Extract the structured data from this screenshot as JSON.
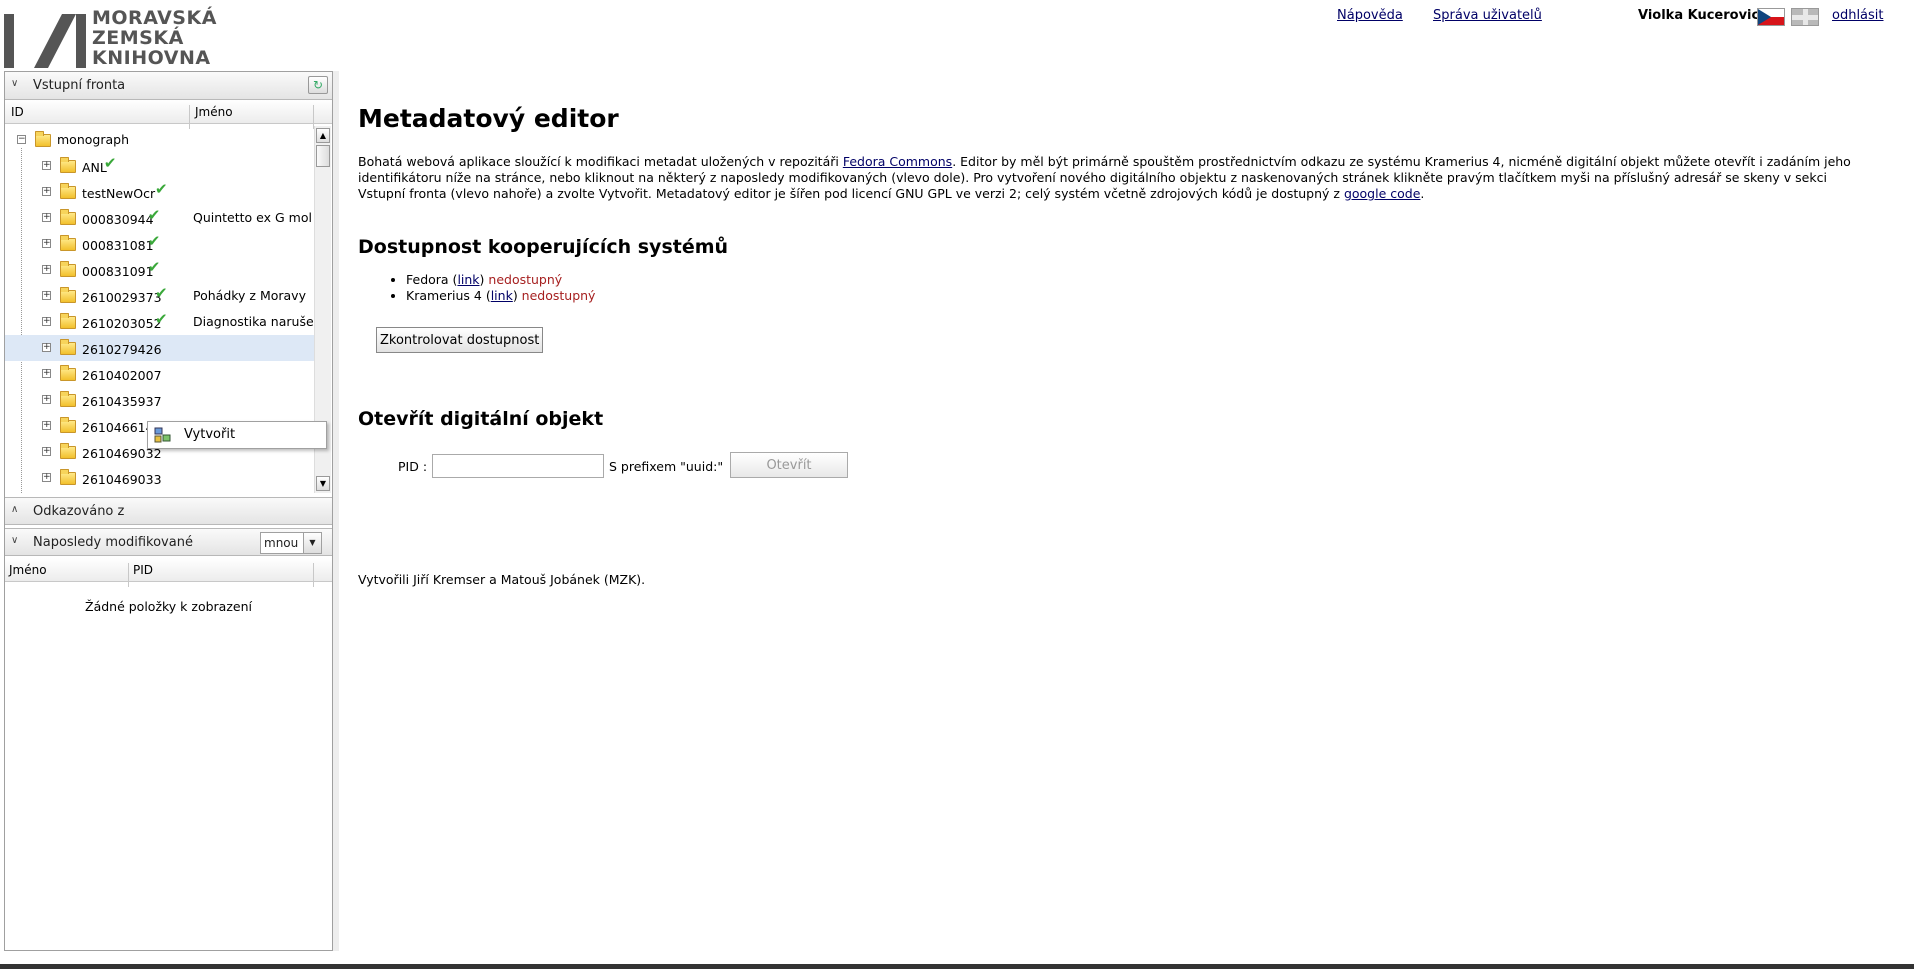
{
  "header": {
    "logo_lines": [
      "MORAVSKÁ",
      "ZEMSKÁ",
      "KNIHOVNA"
    ],
    "help_link": "Nápověda",
    "users_link": "Správa uživatelů",
    "user_name": "Violka Kucerovic",
    "logout_link": "odhlásit"
  },
  "input_queue": {
    "title": "Vstupní fronta",
    "col_id": "ID",
    "col_name": "Jméno",
    "root": "monograph",
    "items": [
      {
        "id": "ANL",
        "name": "",
        "done": true
      },
      {
        "id": "testNewOcr",
        "name": "",
        "done": true
      },
      {
        "id": "000830944",
        "name": "Quintetto ex G mol I",
        "done": true
      },
      {
        "id": "000831081",
        "name": "",
        "done": true
      },
      {
        "id": "000831091",
        "name": "",
        "done": true
      },
      {
        "id": "2610029373",
        "name": "Pohádky z Moravy",
        "done": true
      },
      {
        "id": "2610203052",
        "name": "Diagnostika narušen",
        "done": true
      },
      {
        "id": "2610279426",
        "name": "",
        "done": false
      },
      {
        "id": "2610402007",
        "name": "",
        "done": false
      },
      {
        "id": "2610435937",
        "name": "",
        "done": false
      },
      {
        "id": "2610466147",
        "name": "",
        "done": false
      },
      {
        "id": "2610469032",
        "name": "",
        "done": false
      },
      {
        "id": "2610469033",
        "name": "",
        "done": false
      }
    ],
    "context_menu": {
      "create": "Vytvořit"
    }
  },
  "referenced_from": {
    "title": "Odkazováno z"
  },
  "recent": {
    "title": "Naposledy modifikované",
    "filter_value": "mnou",
    "col_name": "Jméno",
    "col_pid": "PID",
    "empty_text": "Žádné položky k zobrazení"
  },
  "main": {
    "title": "Metadatový editor",
    "intro_1": "Bohatá webová aplikace sloužící k modifikaci metadat uložených v repozitáři ",
    "intro_link_fedora": "Fedora Commons",
    "intro_2": ". Editor by měl být primárně spouštěm prostřednictvím odkazu ze systému Kramerius 4, nicméně digitální objekt můžete otevřít i zadáním jeho identifikátoru níže na stránce, nebo kliknout na některý z naposledy modifikovaných (vlevo dole). Pro vytvoření nového digitálního objektu z naskenovaných stránek klikněte pravým tlačítkem myši na příslušný adresář se skeny v sekci Vstupní fronta (vlevo nahoře) a zvolte Vytvořit. Metadatový editor je šířen pod licencí GNU GPL ve verzi 2; celý systém včetně zdrojových kódů je dostupný z ",
    "intro_link_google": "google code",
    "intro_3": ".",
    "availability_title": "Dostupnost kooperujících systémů",
    "services": [
      {
        "name": "Fedora",
        "link": "link",
        "status": "nedostupný"
      },
      {
        "name": "Kramerius 4",
        "link": "link",
        "status": "nedostupný"
      }
    ],
    "check_button": "Zkontrolovat dostupnost",
    "open_title": "Otevřít digitální objekt",
    "pid_label": "PID :",
    "pid_value": "",
    "prefix_note": "S prefixem \"uuid:\"",
    "open_button": "Otevřít",
    "credit": "Vytvořili Jiří Kremser a Matouš Jobánek (MZK)."
  },
  "colors": {
    "unavailable": "#a62020",
    "check": "#3aa83a",
    "selected_row": "#dde8f6"
  }
}
